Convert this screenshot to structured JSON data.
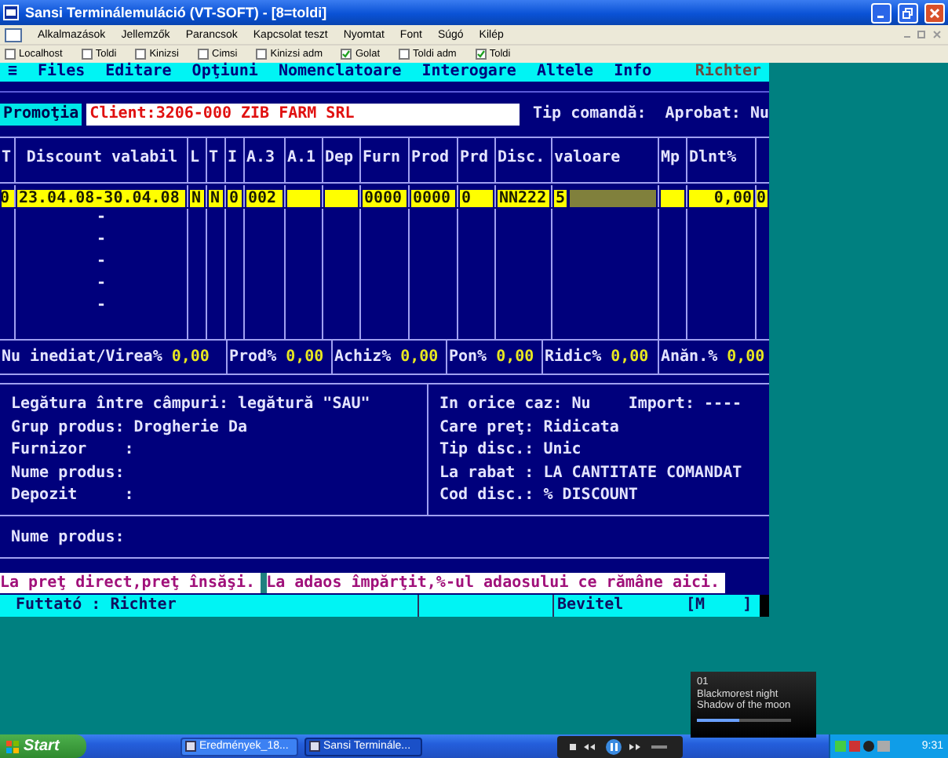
{
  "window": {
    "title": "Sansi Terminálemuláció (VT-SOFT) - [8=toldi]"
  },
  "menu": [
    "Alkalmazások",
    "Jellemzők",
    "Parancsok",
    "Kapcsolat teszt",
    "Nyomtat",
    "Font",
    "Súgó",
    "Kilép"
  ],
  "hosts": [
    {
      "label": "Localhost",
      "checked": false
    },
    {
      "label": "Toldi",
      "checked": false
    },
    {
      "label": "Kinizsi",
      "checked": false
    },
    {
      "label": "Cimsi",
      "checked": false
    },
    {
      "label": "Kinizsi adm",
      "checked": false
    },
    {
      "label": "Golat",
      "checked": true
    },
    {
      "label": "Toldi adm",
      "checked": false
    },
    {
      "label": "Toldi",
      "checked": true
    }
  ],
  "terminal": {
    "menu": [
      "≡",
      "Files",
      "Editare",
      "Opţiuni",
      "Nomenclatoare",
      "Interogare",
      "Altele",
      "Info"
    ],
    "user": "Richter",
    "promo_button": "Promoţia",
    "client": "Client:3206-000 ZIB FARM SRL",
    "order_type": "Tip comandă:",
    "approved": "Aprobat: Nu",
    "table": {
      "columns": [
        "T",
        "Discount valabil",
        "L",
        "T",
        "I",
        "A.3",
        "A.1",
        "Dep",
        "Furn",
        "Prod",
        "Prd",
        "Disc.",
        "valoare",
        "Mp",
        "Dlnt%"
      ],
      "rows": [
        {
          "selected": true,
          "cells": [
            "0",
            "23.04.08-30.04.08",
            "N",
            "N",
            "0",
            "002",
            null,
            null,
            "0000",
            "0000",
            "0",
            "NN222",
            "5",
            null,
            "0,00",
            "0"
          ]
        },
        {
          "selected": false,
          "cells": [
            null,
            "-"
          ]
        },
        {
          "selected": false,
          "cells": [
            null,
            "-"
          ]
        },
        {
          "selected": false,
          "cells": [
            null,
            "-"
          ]
        },
        {
          "selected": false,
          "cells": [
            null,
            "-"
          ]
        },
        {
          "selected": false,
          "cells": [
            null,
            "-"
          ]
        }
      ]
    },
    "totals": [
      {
        "label": "Nu inediat/Virea%",
        "value": "0,00"
      },
      {
        "label": "Prod%",
        "value": "0,00"
      },
      {
        "label": "Achiz%",
        "value": "0,00"
      },
      {
        "label": "Pon%",
        "value": "0,00"
      },
      {
        "label": "Ridic%",
        "value": "0,00"
      },
      {
        "label": "Anăn.%",
        "value": "0,00"
      }
    ],
    "left_info": [
      "Legătura între câmpuri: legătură \"SAU\"",
      "Grup produs: Drogherie Da",
      "Furnizor    :",
      "Nume produs:",
      "Depozit     :"
    ],
    "right_info": [
      [
        "In orice caz: Nu",
        "Import: ----"
      ],
      [
        "Care preţ: Ridicata"
      ],
      [
        "Tip disc.: Unic"
      ],
      [
        "La rabat : LA CANTITATE COMANDAT"
      ],
      [
        "Cod disc.: % DISCOUNT"
      ]
    ],
    "product_name": "Nume produs:",
    "messages": [
      "La preţ direct,preţ însăşi.",
      "La adaos împărţit,%-ul adaosului ce rămâne aici."
    ],
    "status": {
      "user": "Futtató : Richter",
      "mode": "Bevitel",
      "input": "[M    ]"
    }
  },
  "media": {
    "track": "01",
    "artist": "Blackmorest night",
    "title": "Shadow of the moon",
    "level": 0.45
  },
  "taskbar": {
    "start": "Start",
    "tasks": [
      {
        "label": "Eredmények_18...",
        "selected": false
      },
      {
        "label": "Sansi Terminále...",
        "selected": true
      }
    ],
    "clock": "9:31"
  }
}
